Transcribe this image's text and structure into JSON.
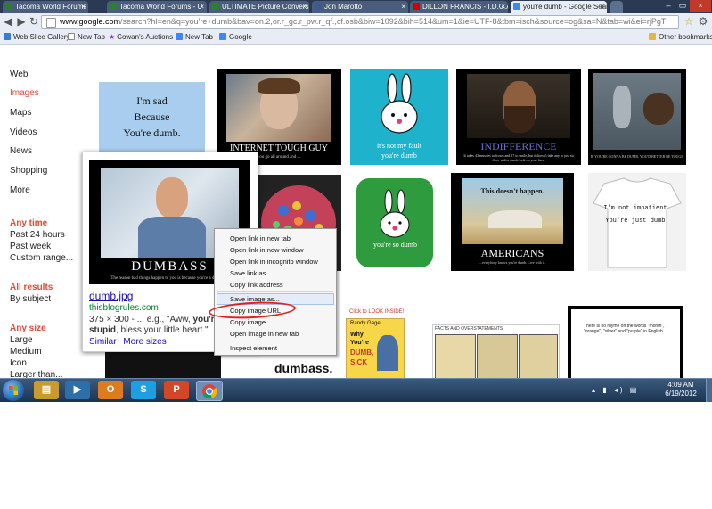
{
  "browser": {
    "tabs": [
      {
        "title": "Tacoma World Forums - U",
        "favicon_color": "#2e7d32"
      },
      {
        "title": "Tacoma World Forums - U",
        "favicon_color": "#2e7d32"
      },
      {
        "title": "ULTIMATE Picture Convers",
        "favicon_color": "#2e7d32"
      },
      {
        "title": "Jon Marotto",
        "favicon_color": "#3b5998"
      },
      {
        "title": "DILLON FRANCIS - I.D.G.A.F",
        "favicon_color": "#cc0000"
      },
      {
        "title": "you're dumb - Google Sear",
        "favicon_color": "#4285f4"
      }
    ],
    "url_host": "www.google.com",
    "url_rest": "/search?hl=en&q=you're+dumb&bav=on.2,or.r_gc.r_pw.r_qf.,cf.osb&biw=1092&bih=514&um=1&ie=UTF-8&tbm=isch&source=og&sa=N&tab=wi&ei=rjPgT",
    "bookmarks": [
      "Web Slice Gallery",
      "New Tab",
      "Cowan's Auctions",
      "New Tab",
      "Google"
    ],
    "other_bookmarks": "Other bookmarks"
  },
  "leftnav": {
    "links": [
      "Web",
      "Images",
      "Maps",
      "Videos",
      "News",
      "Shopping",
      "More"
    ],
    "time_header": "Any time",
    "time_opts": [
      "Past 24 hours",
      "Past week",
      "Custom range..."
    ],
    "results_header": "All results",
    "results_opts": [
      "By subject"
    ],
    "size_header": "Any size",
    "size_opts": [
      "Large",
      "Medium",
      "Icon",
      "Larger than..."
    ]
  },
  "tiles": {
    "sad1": "I'm sad",
    "sad2": "Because",
    "sad3": "You're dumb.",
    "tough_title": "INTERNET TOUGH GUY",
    "tough_sub": "you go all around and ...",
    "bunny1_l1": "it's not my fault",
    "bunny1_l2": "you're dumb",
    "indiff_title": "INDIFFERENCE",
    "indiff_sub": "It takes 43 muscles to frown and 17 to smile, but it doesn't take any to just sit there with a dumb look on your face.",
    "bear_sub": "IF YOU'RE GONNA BE DUMB, YOU'D BETTER BE TOUGH",
    "bunny2_text": "you're so dumb",
    "am_top": "This doesn't happen.",
    "am_title": "AMERICANS",
    "am_sub": "...everybody knows you're dumb. Live with it.",
    "shirt_l1": "I'm not impatient.",
    "shirt_l2": "You're just dumb.",
    "book_link": "Click to LOOK INSIDE!",
    "book_author": "Randy Gage",
    "book_t1": "Why",
    "book_t2": "You're",
    "book_t3": "DUMB,",
    "book_t4": "SICK",
    "comic_title": "FACTS AND OVERSTATEMENTS",
    "note_text": "There is no rhyme on the words \"month\", \"orange\", \"silver\" and \"purple\" in English.",
    "bottom_text": "dumbass."
  },
  "hovercard": {
    "poster_title": "DUMBASS",
    "poster_sub": "The reason bad things happen to you is because you're a dumbass.",
    "filename": "dumb.jpg",
    "domain": "thisblogrules.com",
    "meta_pre": "375 × 300 - ... e.g., \"Aww, ",
    "meta_bold1": "you're",
    "meta_mid": " a",
    "meta_bold2": "stupid",
    "meta_post": ", bless your little heart.\"",
    "similar": "Similar",
    "more_sizes": "More sizes"
  },
  "context_menu": {
    "items": [
      "Open link in new tab",
      "Open link in new window",
      "Open link in incognito window",
      "Save link as...",
      "Copy link address",
      "Save image as...",
      "Copy image URL",
      "Copy image",
      "Open image in new tab",
      "Inspect element"
    ]
  },
  "taskbar": {
    "time": "4:09 AM",
    "date": "6/19/2012"
  }
}
